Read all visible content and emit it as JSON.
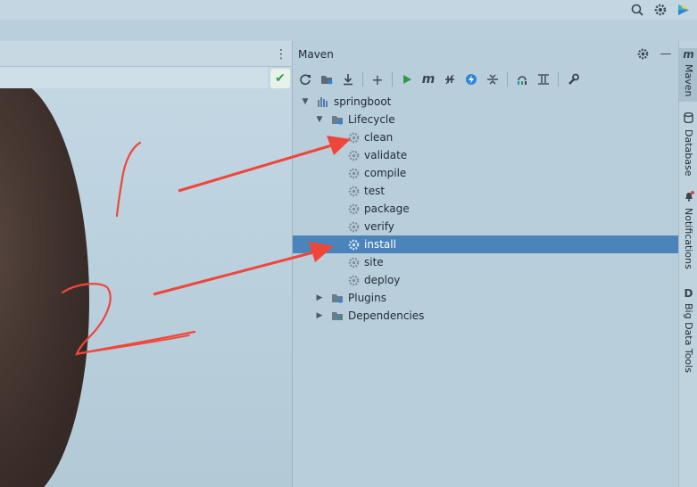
{
  "maven": {
    "title": "Maven",
    "toolbar": [
      "reload-icon",
      "generate-sources-icon",
      "download-icon",
      "add-icon",
      "run-icon",
      "maven-goal-icon",
      "toggle-offline-icon",
      "skip-tests-icon",
      "collapse-icon",
      "show-dependencies-icon",
      "diagram-icon",
      "settings-icon"
    ],
    "tree": {
      "root": "springboot",
      "lifecycle_label": "Lifecycle",
      "lifecycle": [
        "clean",
        "validate",
        "compile",
        "test",
        "package",
        "verify",
        "install",
        "site",
        "deploy"
      ],
      "selected": "install",
      "plugins_label": "Plugins",
      "dependencies_label": "Dependencies"
    }
  },
  "right_strip": {
    "maven_label": "Maven",
    "database_label": "Database",
    "notifications_label": "Notifications",
    "bigdata_label": "Big Data Tools",
    "bigdata_icon_letter": "D"
  },
  "colors": {
    "selection": "#4a84bb",
    "annotation": "#f0463a",
    "run_green": "#2e9b4a",
    "action_blue": "#2f86d6"
  }
}
